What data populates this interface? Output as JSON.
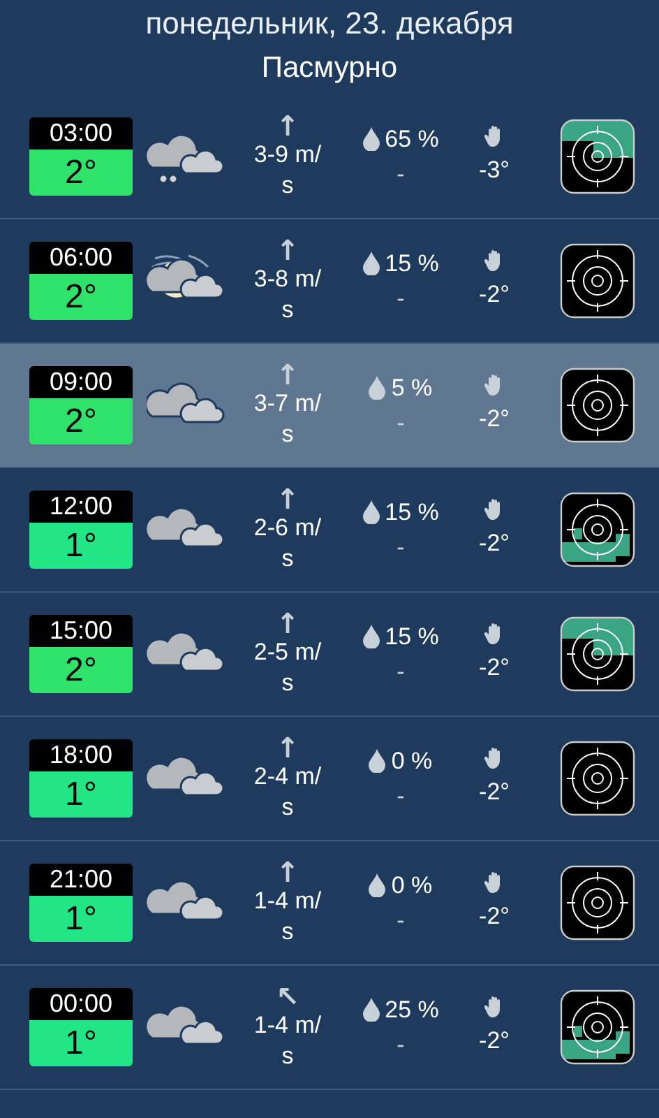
{
  "date": "понедельник, 23. декабря",
  "condition": "Пасмурно",
  "rows": [
    {
      "time": "03:00",
      "temp": "2°",
      "color": "#2ee26a",
      "weather": {
        "kind": "snow"
      },
      "wind_arrow": "↑",
      "wind": "3-9 m/ s",
      "precip": "65 %",
      "precip_amount": "-",
      "feels": "-3°",
      "radar": {
        "kind": "echo"
      },
      "selected": false
    },
    {
      "time": "06:00",
      "temp": "2°",
      "color": "#2ee26a",
      "weather": {
        "kind": "night"
      },
      "wind_arrow": "↑",
      "wind": "3-8 m/ s",
      "precip": "15 %",
      "precip_amount": "-",
      "feels": "-2°",
      "radar": {
        "kind": "clear"
      },
      "selected": false
    },
    {
      "time": "09:00",
      "temp": "2°",
      "color": "#2ee26a",
      "weather": {
        "kind": "cloudy"
      },
      "wind_arrow": "↑",
      "wind": "3-7 m/ s",
      "precip": "5 %",
      "precip_amount": "-",
      "feels": "-2°",
      "radar": {
        "kind": "clear"
      },
      "selected": true
    },
    {
      "time": "12:00",
      "temp": "1°",
      "color": "#22e585",
      "weather": {
        "kind": "cloudy"
      },
      "wind_arrow": "↑",
      "wind": "2-6 m/ s",
      "precip": "15 %",
      "precip_amount": "-",
      "feels": "-2°",
      "radar": {
        "kind": "echo"
      },
      "selected": false
    },
    {
      "time": "15:00",
      "temp": "2°",
      "color": "#2ee26a",
      "weather": {
        "kind": "cloudy"
      },
      "wind_arrow": "↑",
      "wind": "2-5 m/ s",
      "precip": "15 %",
      "precip_amount": "-",
      "feels": "-2°",
      "radar": {
        "kind": "echo"
      },
      "selected": false
    },
    {
      "time": "18:00",
      "temp": "1°",
      "color": "#22e585",
      "weather": {
        "kind": "cloudy"
      },
      "wind_arrow": "↑",
      "wind": "2-4 m/ s",
      "precip": "0 %",
      "precip_amount": "-",
      "feels": "-2°",
      "radar": {
        "kind": "clear"
      },
      "selected": false
    },
    {
      "time": "21:00",
      "temp": "1°",
      "color": "#22e585",
      "weather": {
        "kind": "cloudy"
      },
      "wind_arrow": "↑",
      "wind": "1-4 m/ s",
      "precip": "0 %",
      "precip_amount": "-",
      "feels": "-2°",
      "radar": {
        "kind": "clear"
      },
      "selected": false
    },
    {
      "time": "00:00",
      "temp": "1°",
      "color": "#22e585",
      "weather": {
        "kind": "cloudy"
      },
      "wind_arrow": "↖",
      "wind": "1-4 m/ s",
      "precip": "25 %",
      "precip_amount": "-",
      "feels": "-2°",
      "radar": {
        "kind": "echo"
      },
      "selected": false
    }
  ]
}
